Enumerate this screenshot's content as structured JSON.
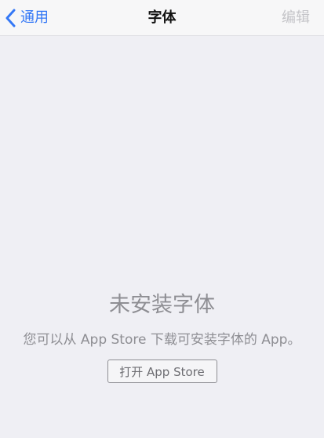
{
  "navbar": {
    "back_label": "通用",
    "title": "字体",
    "edit_label": "编辑"
  },
  "empty_state": {
    "title": "未安装字体",
    "description": "您可以从 App Store 下载可安装字体的 App。",
    "button_label": "打开 App Store"
  },
  "colors": {
    "accent": "#3478f6",
    "disabled": "#c4c4c8",
    "secondary_text": "#8e8e93",
    "background": "#efeff4"
  },
  "icons": {
    "back": "chevron-left-icon"
  }
}
